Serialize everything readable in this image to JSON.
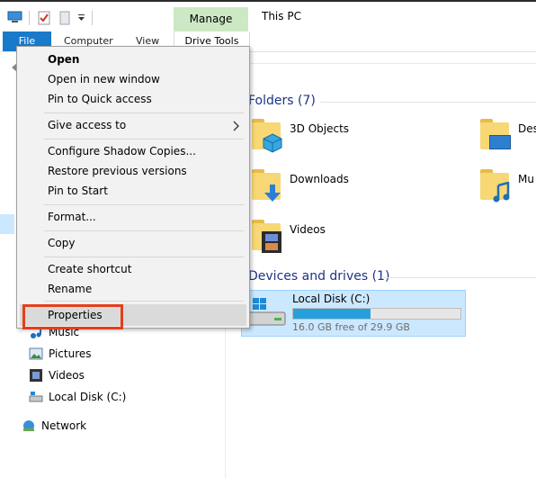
{
  "ribbon": {
    "file": "File",
    "computer": "Computer",
    "view": "View",
    "manage": "Manage",
    "drive_tools": "Drive Tools"
  },
  "window_title": "This PC",
  "context_menu": {
    "open": "Open",
    "open_new_window": "Open in new window",
    "pin_quick_access": "Pin to Quick access",
    "give_access": "Give access to",
    "configure_shadow": "Configure Shadow Copies...",
    "restore_previous": "Restore previous versions",
    "pin_start": "Pin to Start",
    "format": "Format...",
    "copy": "Copy",
    "create_shortcut": "Create shortcut",
    "rename": "Rename",
    "properties": "Properties"
  },
  "nav": {
    "music": "Music",
    "pictures": "Pictures",
    "videos": "Videos",
    "local_disk": "Local Disk (C:)",
    "network": "Network"
  },
  "content": {
    "folders_header": "Folders (7)",
    "devices_header": "Devices and drives (1)",
    "folders": {
      "objects3d": "3D Objects",
      "desktop": "Des",
      "downloads": "Downloads",
      "music": "Mu",
      "videos": "Videos"
    },
    "drive": {
      "name": "Local Disk (C:)",
      "free": "16.0 GB free of 29.9 GB",
      "used_fraction": 0.465
    }
  },
  "colors": {
    "file_tab": "#1979ca",
    "manage_tab": "#cde8c4",
    "selection": "#cce8ff",
    "highlight_box": "#e2401c",
    "header_blue": "#1e3287"
  }
}
